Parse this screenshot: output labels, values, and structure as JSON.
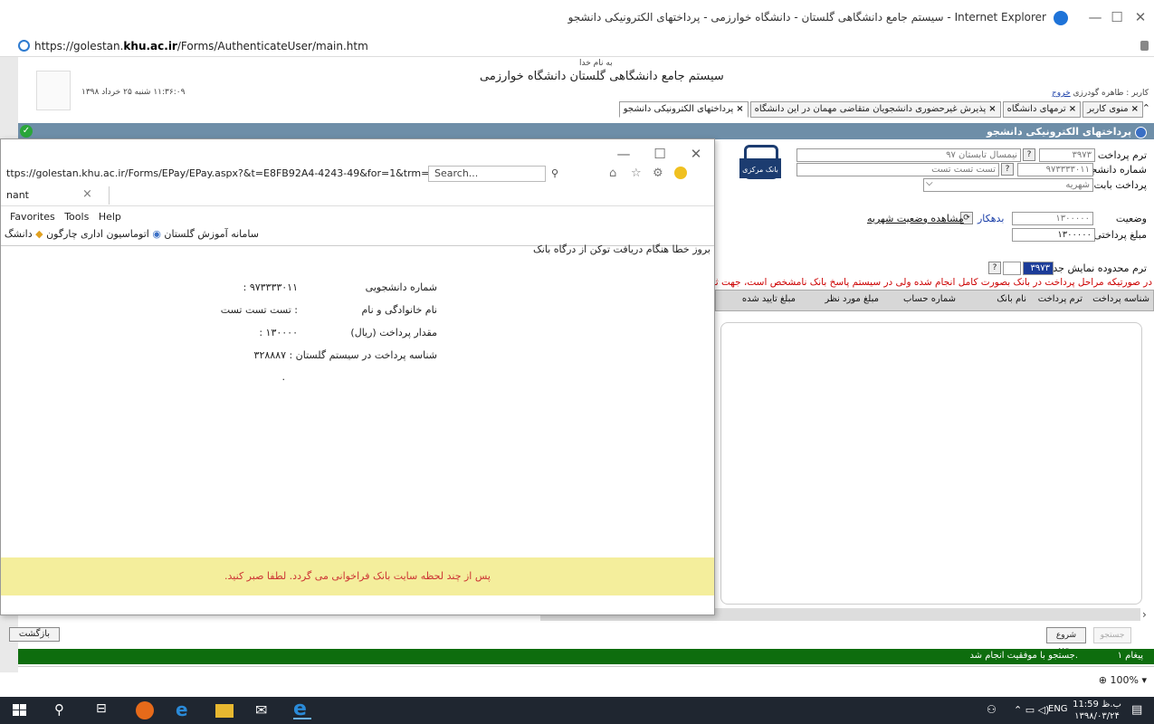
{
  "window": {
    "title": "سیستم جامع دانشگاهی گلستان - دانشگاه خوارزمی - پرداختهای الکترونیکی دانشجو - Internet Explorer",
    "minimize": "—",
    "maximize": "☐",
    "close": "✕"
  },
  "address": {
    "prefix": "https://golestan.",
    "host": "khu.ac.ir",
    "path": "/Forms/AuthenticateUser/main.htm"
  },
  "header": {
    "bismillah": "به نام خدا",
    "system_title": "سیستم جامع دانشگاهی گلستان   دانشگاه خوارزمی",
    "datetime": "۱۱:۳۶:۰۹ شنبه ۲۵ خرداد ۱۳۹۸",
    "user_label": "کاربر : طاهره گودرزی",
    "logout": "خروج"
  },
  "tabs": [
    {
      "label": "پرداختهای الکترونیکی دانشجو",
      "active": true
    },
    {
      "label": "پذیرش غیرحضوری دانشجویان متقاضی مهمان در این دانشگاه",
      "active": false
    },
    {
      "label": "ترمهای دانشگاه",
      "active": false
    },
    {
      "label": "منوی کاربر",
      "active": false
    }
  ],
  "form": {
    "title": "پرداختهای الکترونیکی دانشجو",
    "term_label": "ترم پرداخت",
    "term_value": "۳۹۷۳",
    "term_desc": "نیمسال تابستان ۹۷",
    "student_label": "شماره دانشجو",
    "student_value": "۹۷۳۳۳۳۰۱۱",
    "student_name": "تست تست تست",
    "pay_for_label": "پرداخت بابت",
    "pay_for_value": "شهریه",
    "status_label": "وضعیت",
    "status_value": "۱۳۰۰۰۰۰",
    "status_suffix": "بدهکار",
    "view_status_link": "مشاهده وضعیت شهریه",
    "amount_label": "مبلغ پرداختی",
    "amount_value": "۱۳۰۰۰۰۰",
    "bank_label": "بانک مرکزی",
    "range_label": "ترم محدوده نمایش جدول",
    "range_value": "۳۹۷۳",
    "warning": "در صورتیکه مراحل پرداخت در بانک بصورت کامل انجام شده ولی در سیستم پاسخ بانک نامشخص است، جهت ثبت"
  },
  "grid": {
    "columns": [
      "شناسه پرداخت",
      "ترم پرداخت",
      "نام بانک",
      "شماره حساب",
      "مبلغ مورد نظر",
      "مبلغ تایید شده"
    ]
  },
  "popup": {
    "url": "ttps://golestan.khu.ac.ir/Forms/EPay/EPay.aspx?&t=E8FB92A4-4243-49&for=1&trm=39",
    "search_placeholder": "Search...",
    "tab_label": "nant",
    "menu": [
      "Favorites",
      "Tools",
      "Help"
    ],
    "favorites": [
      "سامانه آموزش گلستان",
      "اتوماسیون اداری چارگون",
      "دانشگ"
    ],
    "error": "بروز خطا هنگام دریافت توکن از درگاه بانک",
    "fields": [
      {
        "label": "شماره دانشجویی",
        "value": "۹۷۳۳۳۳۰۱۱ :"
      },
      {
        "label": "نام خانوادگی و نام",
        "value": ": تست تست تست"
      },
      {
        "label": "مقدار پرداخت (ریال)",
        "value": "۱۳۰۰۰۰ :"
      },
      {
        "label": "شناسه پرداخت در سیستم گلستان : ۳۲۸۸۸۷",
        "value": ""
      }
    ],
    "dot": ".",
    "wait_message": "پس از چند لحظه سایت بانک فراخوانی می گردد. لطفا صبر کنید."
  },
  "bottom": {
    "back_button": "بازگشت",
    "start_button": "شروع مجدد",
    "search_button": "جستجو",
    "message_count": "۱ پیغام",
    "message_text": "جستجو با موفقیت انجام شد.",
    "zoom": "100%"
  },
  "taskbar": {
    "time": "11:59 ب.ظ",
    "date": "۱۳۹۸/۰۳/۲۴",
    "lang": "ENG"
  }
}
